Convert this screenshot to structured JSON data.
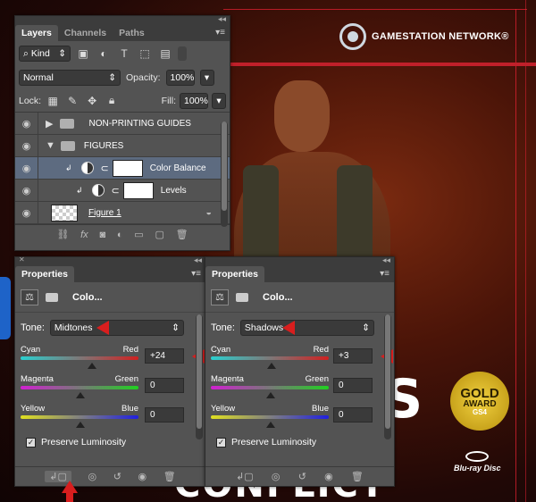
{
  "poster": {
    "network_label": "GAMESTATION NETWORK®",
    "award": {
      "line1": "GOLD",
      "line2": "AWARD",
      "line3": "GS4"
    },
    "bluray_label": "Blu-ray Disc",
    "big_text_top": "S",
    "big_text_bottom": "CONFLICT"
  },
  "layers_panel": {
    "tabs": [
      "Layers",
      "Channels",
      "Paths"
    ],
    "active_tab": "Layers",
    "filter_kind": "Kind",
    "blend_mode": "Normal",
    "opacity_label": "Opacity:",
    "opacity_value": "100%",
    "lock_label": "Lock:",
    "fill_label": "Fill:",
    "fill_value": "100%",
    "layers": [
      {
        "name": "NON-PRINTING GUIDES",
        "type": "group",
        "expanded": false
      },
      {
        "name": "FIGURES",
        "type": "group",
        "expanded": true
      },
      {
        "name": "Color Balance",
        "type": "adjustment",
        "selected": true
      },
      {
        "name": "Levels",
        "type": "adjustment"
      },
      {
        "name": "Figure 1",
        "type": "smart-object"
      }
    ],
    "bottom_icons": [
      "link-icon",
      "fx-icon",
      "mask-icon",
      "adjustment-icon",
      "folder-icon",
      "new-layer-icon",
      "trash-icon"
    ],
    "fx_label": "fx"
  },
  "properties_left": {
    "tab": "Properties",
    "title": "Colo...",
    "tone_label": "Tone:",
    "tone_value": "Midtones",
    "sliders": [
      {
        "left": "Cyan",
        "right": "Red",
        "value": "+24",
        "position": 0.6
      },
      {
        "left": "Magenta",
        "right": "Green",
        "value": "0",
        "position": 0.5
      },
      {
        "left": "Yellow",
        "right": "Blue",
        "value": "0",
        "position": 0.5
      }
    ],
    "preserve_label": "Preserve Luminosity"
  },
  "properties_right": {
    "tab": "Properties",
    "title": "Colo...",
    "tone_label": "Tone:",
    "tone_value": "Shadows",
    "sliders": [
      {
        "left": "Cyan",
        "right": "Red",
        "value": "+3",
        "position": 0.51
      },
      {
        "left": "Magenta",
        "right": "Green",
        "value": "0",
        "position": 0.5
      },
      {
        "left": "Yellow",
        "right": "Blue",
        "value": "0",
        "position": 0.5
      }
    ],
    "preserve_label": "Preserve Luminosity"
  }
}
